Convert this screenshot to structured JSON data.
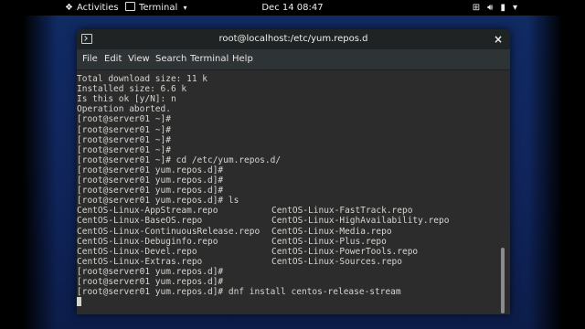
{
  "topbar": {
    "activities": "Activities",
    "app_menu": "Terminal",
    "clock": "Dec 14  08:47",
    "icons": [
      "network-icon",
      "volume-icon",
      "battery-icon",
      "system-menu-arrow-icon"
    ]
  },
  "window": {
    "title": "root@localhost:/etc/yum.repos.d",
    "close_glyph": "×"
  },
  "menu": [
    "File",
    "Edit",
    "View",
    "Search",
    "Terminal",
    "Help"
  ],
  "terminal": {
    "lines": [
      "Total download size: 11 k",
      "Installed size: 6.6 k",
      "Is this ok [y/N]: n",
      "Operation aborted.",
      "[root@server01 ~]#",
      "[root@server01 ~]#",
      "[root@server01 ~]#",
      "[root@server01 ~]#",
      "[root@server01 ~]# cd /etc/yum.repos.d/",
      "[root@server01 yum.repos.d]#",
      "[root@server01 yum.repos.d]#",
      "[root@server01 yum.repos.d]#",
      "[root@server01 yum.repos.d]# ls"
    ],
    "ls_left": [
      "CentOS-Linux-AppStream.repo",
      "CentOS-Linux-BaseOS.repo",
      "CentOS-Linux-ContinuousRelease.repo",
      "CentOS-Linux-Debuginfo.repo",
      "CentOS-Linux-Devel.repo",
      "CentOS-Linux-Extras.repo"
    ],
    "ls_right": [
      "CentOS-Linux-FastTrack.repo",
      "CentOS-Linux-HighAvailability.repo",
      "CentOS-Linux-Media.repo",
      "CentOS-Linux-Plus.repo",
      "CentOS-Linux-PowerTools.repo",
      "CentOS-Linux-Sources.repo"
    ],
    "after": [
      "[root@server01 yum.repos.d]#",
      "[root@server01 yum.repos.d]#",
      "[root@server01 yum.repos.d]# dnf install centos-release-stream"
    ]
  }
}
